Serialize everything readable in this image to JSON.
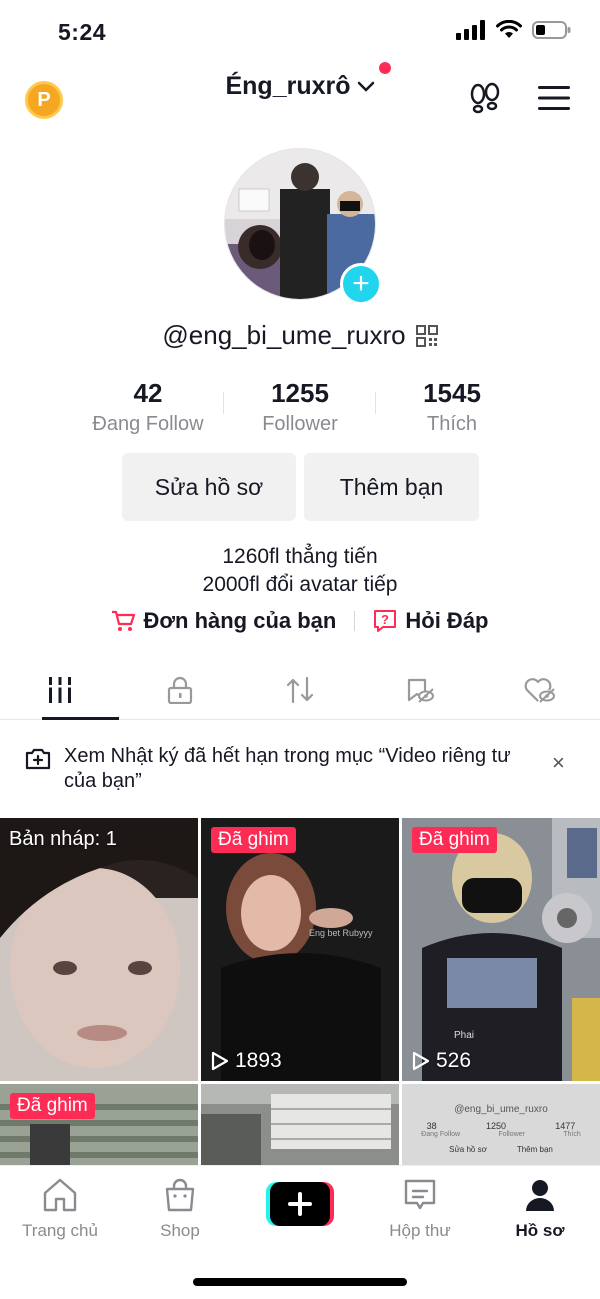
{
  "status": {
    "time": "5:24"
  },
  "header": {
    "coin_letter": "P",
    "title": "Éng_ruxrô"
  },
  "profile": {
    "handle": "@eng_bi_ume_ruxro",
    "stats": [
      {
        "value": "42",
        "label": "Đang Follow"
      },
      {
        "value": "1255",
        "label": "Follower"
      },
      {
        "value": "1545",
        "label": "Thích"
      }
    ],
    "buttons": {
      "edit": "Sửa hồ sơ",
      "add_friends": "Thêm bạn"
    },
    "bio": [
      "1260fl thẳng tiến",
      "2000fl đổi avatar tiếp"
    ],
    "links": {
      "orders": "Đơn hàng của bạn",
      "qa": "Hỏi Đáp"
    }
  },
  "tabs": [
    "videos-grid",
    "private-lock",
    "reposts",
    "favorites-hidden",
    "liked-hidden"
  ],
  "banner": {
    "text": "Xem Nhật ký đã hết hạn trong mục “Video riêng tư của bạn”",
    "close": "×"
  },
  "grid": {
    "draft_label": "Bản nháp: 1",
    "pinned_label": "Đã ghim",
    "views": [
      "1893",
      "526"
    ]
  },
  "thumb_text": {
    "shirt_text": "Eng bet Rubyyy",
    "shirt_text2": "Phai",
    "mini_profile": {
      "handle": "@eng_bi_ume_ruxro",
      "stats": [
        "38",
        "1250",
        "1477"
      ],
      "labels": [
        "Đang Follow",
        "Follower",
        "Thích"
      ],
      "buttons": [
        "Sửa hồ sơ",
        "Thêm bạn"
      ]
    }
  },
  "bottom_nav": {
    "home": "Trang chủ",
    "shop": "Shop",
    "inbox": "Hộp thư",
    "profile": "Hồ sơ"
  },
  "colors": {
    "accent": "#fe2c55",
    "teal": "#20d5ec",
    "coin": "#f5a623"
  }
}
